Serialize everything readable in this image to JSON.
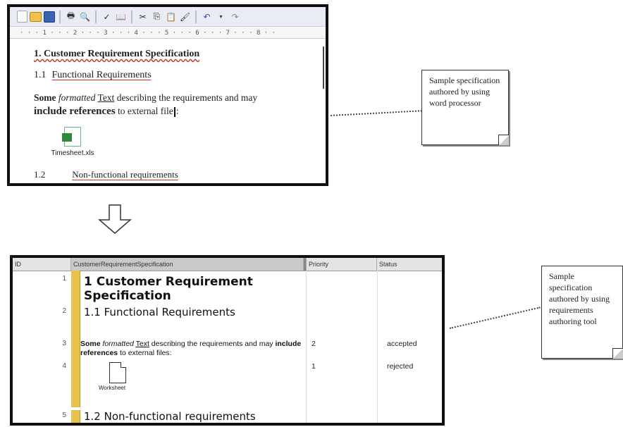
{
  "word_processor": {
    "toolbar_icons": [
      "new-document-icon",
      "open-folder-icon",
      "save-icon",
      "print-icon",
      "print-preview-icon",
      "spell-check-icon",
      "research-icon",
      "cut-icon",
      "copy-icon",
      "paste-icon",
      "format-painter-icon",
      "undo-icon",
      "redo-icon"
    ],
    "ruler": "· · · 1 · · · 2 · · · 3 · · · 4 · · · 5 · · · 6 · · · 7 · · · 8 · ·",
    "heading1": "1. Customer Requirement Specification",
    "heading2_num": "1.1",
    "heading2_text": "Functional Requirements",
    "para_some": "Some",
    "para_formatted": "formatted",
    "para_text": "Text",
    "para_mid1": " describing the requirements and may ",
    "para_include": "include references",
    "para_mid2": " to external file",
    "para_end": ":",
    "attachment": "Timesheet.xls",
    "heading3_num": "1.2",
    "heading3_text": "Non-functional requirements"
  },
  "note_word": "Sample specification authored by using word processor",
  "note_tool": "Sample specification authored by using requirements authoring tool",
  "req_tool": {
    "columns": [
      "ID",
      "CustomerRequirementSpecification",
      "Priority",
      "Status"
    ],
    "rows": [
      {
        "id": "1",
        "text": "1 Customer Requirement Specification",
        "priority": "",
        "status": ""
      },
      {
        "id": "2",
        "text": "1.1 Functional Requirements",
        "priority": "",
        "status": ""
      },
      {
        "id": "3",
        "some": "Some",
        "formatted": "formatted",
        "text_word": "Text",
        "mid1": " describing the requirements and may ",
        "include": "include references",
        "mid2": " to external files:",
        "priority": "2",
        "status": "accepted"
      },
      {
        "id": "4",
        "attachment": "Worksheet",
        "priority": "1",
        "status": "rejected"
      },
      {
        "id": "5",
        "text": "1.2 Non-functional requirements",
        "priority": "",
        "status": ""
      }
    ]
  }
}
